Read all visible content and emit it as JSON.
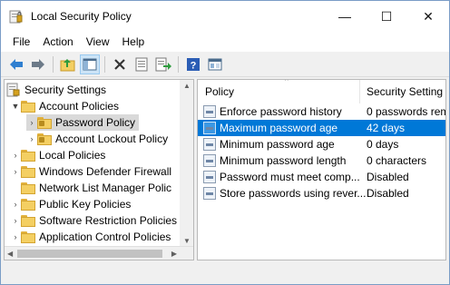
{
  "window": {
    "title": "Local Security Policy",
    "minimize": "—",
    "maximize": "☐",
    "close": "✕"
  },
  "menu": [
    "File",
    "Action",
    "View",
    "Help"
  ],
  "toolbar": [
    "back-icon",
    "forward-icon",
    "up-folder-icon",
    "show-hide-tree-icon",
    "delete-icon",
    "properties-icon",
    "export-list-icon",
    "help-icon",
    "mmc-icon"
  ],
  "tree": {
    "root": "Security Settings",
    "account_policies": "Account Policies",
    "password_policy": "Password Policy",
    "account_lockout": "Account Lockout Policy",
    "local_policies": "Local Policies",
    "windows_defender": "Windows Defender Firewall",
    "network_list": "Network List Manager Polic",
    "public_key": "Public Key Policies",
    "software_restriction": "Software Restriction Policies",
    "app_control": "Application Control Policies"
  },
  "list": {
    "col_policy": "Policy",
    "col_setting": "Security Setting",
    "rows": [
      {
        "name": "Enforce password history",
        "value": "0 passwords rem"
      },
      {
        "name": "Maximum password age",
        "value": "42 days"
      },
      {
        "name": "Minimum password age",
        "value": "0 days"
      },
      {
        "name": "Minimum password length",
        "value": "0 characters"
      },
      {
        "name": "Password must meet comp...",
        "value": "Disabled"
      },
      {
        "name": "Store passwords using rever...",
        "value": "Disabled"
      }
    ]
  },
  "colors": {
    "selection": "#0078d7",
    "tree_selection": "#d9d9d9"
  }
}
